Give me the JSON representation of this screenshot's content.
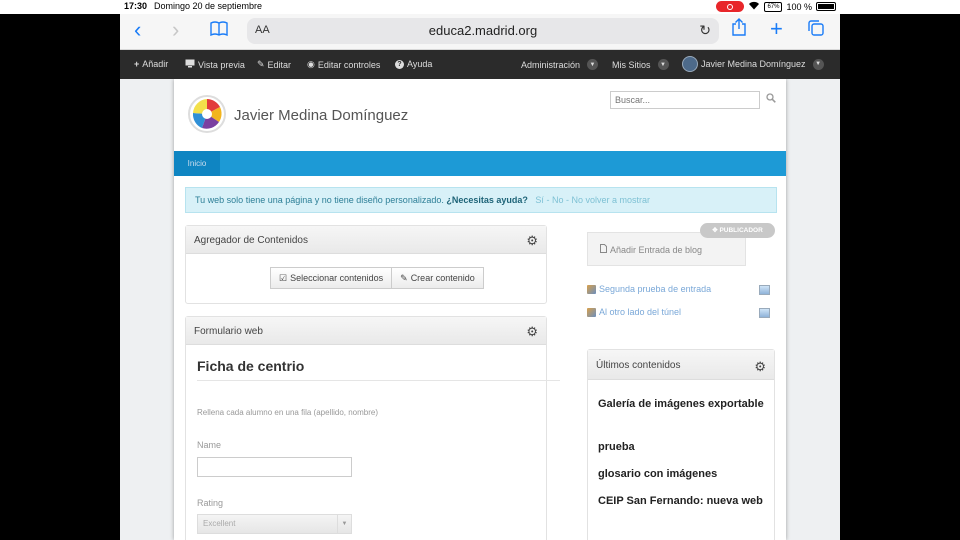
{
  "status": {
    "time": "17:30",
    "date": "Domingo 20 de septiembre",
    "battery_label": "100 %"
  },
  "browser": {
    "text_size_label": "AA",
    "url": "educa2.madrid.org"
  },
  "dockbar": {
    "add": "Añadir",
    "preview": "Vista previa",
    "edit": "Editar",
    "edit_controls": "Editar controles",
    "help": "Ayuda",
    "admin": "Administración",
    "my_sites": "Mis Sitios",
    "user": "Javier Medina Domínguez"
  },
  "site": {
    "title": "Javier Medina Domínguez",
    "search_placeholder": "Buscar...",
    "nav": [
      "Inicio"
    ]
  },
  "alert": {
    "text": "Tu web solo tiene una página y no tiene diseño personalizado.",
    "question": "¿Necesitas ayuda?",
    "yes": "Sí",
    "no": "No",
    "never": "No volver a mostrar",
    "sep": "-"
  },
  "aggregator": {
    "title": "Agregador de Contenidos",
    "select_btn": "Seleccionar contenidos",
    "create_btn": "Crear contenido"
  },
  "form": {
    "portlet_title": "Formulario web",
    "heading": "Ficha de centrio",
    "description": "Rellena cada alumno en una fila (apellido, nombre)",
    "name_label": "Name",
    "rating_label": "Rating",
    "rating_value": "Excellent"
  },
  "blog": {
    "badge": "PUBLICADOR",
    "add_entry": "Añadir Entrada de blog",
    "entries": [
      "Segunda prueba de entrada",
      "Al otro lado del túnel"
    ]
  },
  "latest": {
    "title": "Últimos contenidos",
    "items": [
      "Galería de imágenes exportable",
      "prueba",
      "glosario con imágenes",
      "CEIP San Fernando: nueva web"
    ]
  },
  "colors": {
    "nav_blue": "#1d9ad6",
    "alert_bg": "#d8f1f8",
    "dockbar": "#2b2b2b",
    "safari_blue": "#1a7cf7"
  }
}
